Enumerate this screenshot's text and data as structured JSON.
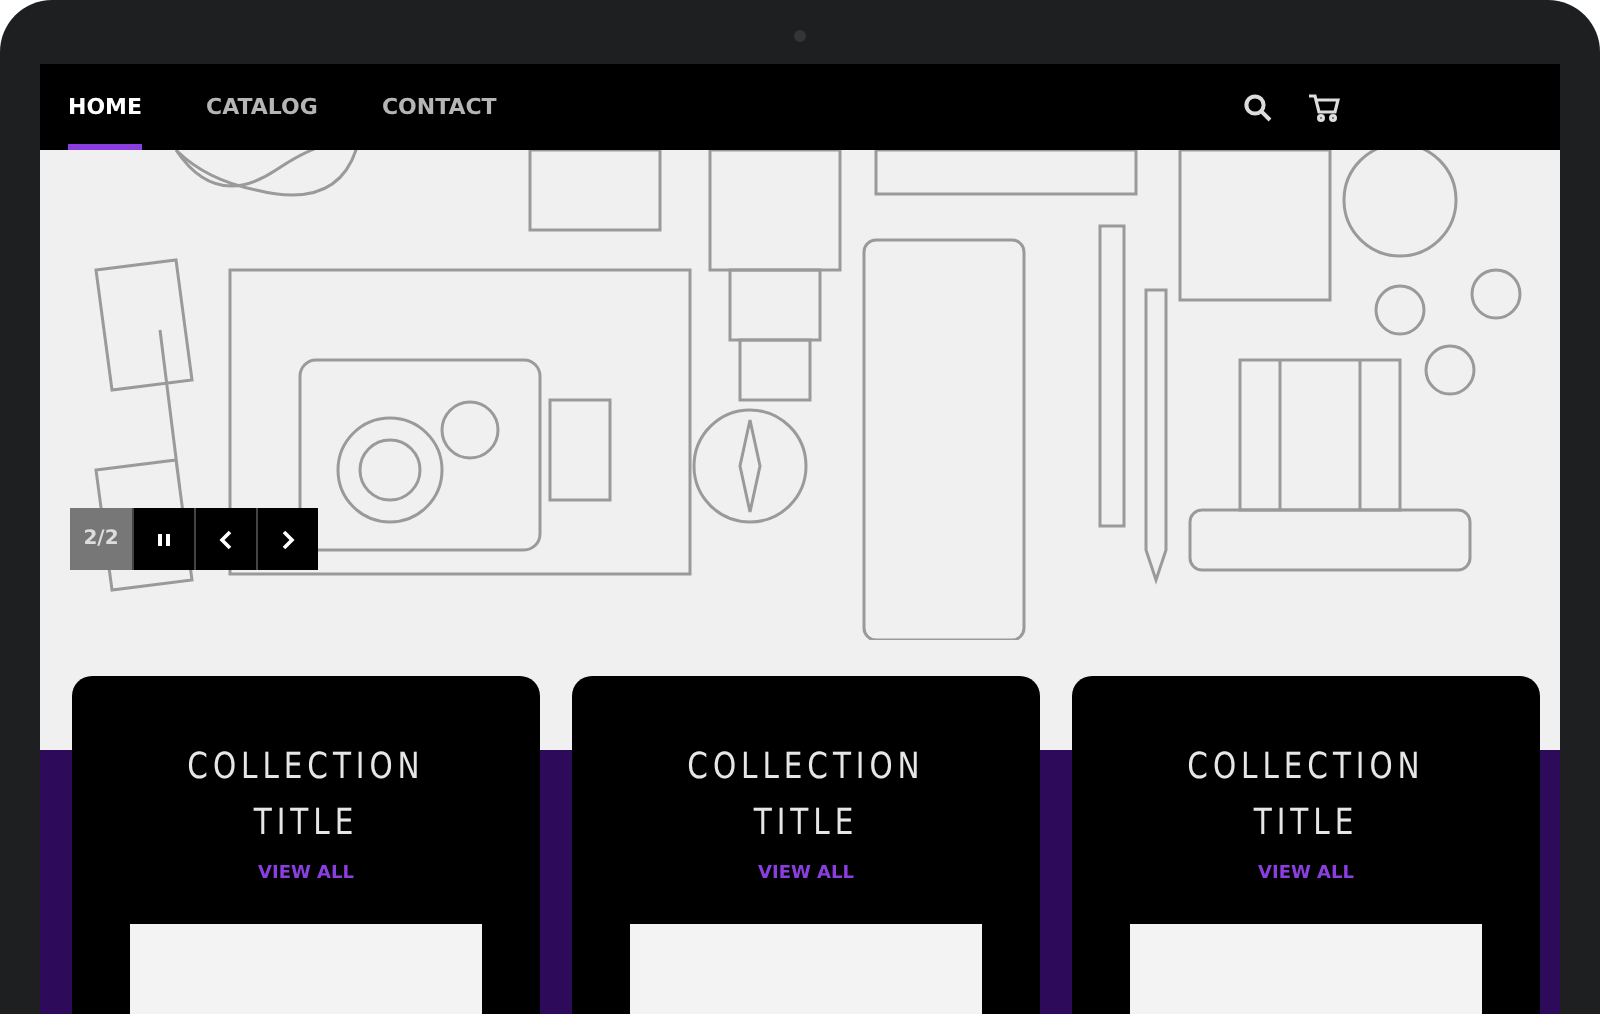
{
  "nav": {
    "items": [
      {
        "label": "HOME",
        "selected": true
      },
      {
        "label": "CATALOG",
        "selected": false
      },
      {
        "label": "CONTACT",
        "selected": false
      }
    ]
  },
  "slideshow": {
    "counter": "2/2"
  },
  "collections": [
    {
      "title": "COLLECTION TITLE",
      "link": "VIEW ALL"
    },
    {
      "title": "COLLECTION TITLE",
      "link": "VIEW ALL"
    },
    {
      "title": "COLLECTION TITLE",
      "link": "VIEW ALL"
    }
  ]
}
